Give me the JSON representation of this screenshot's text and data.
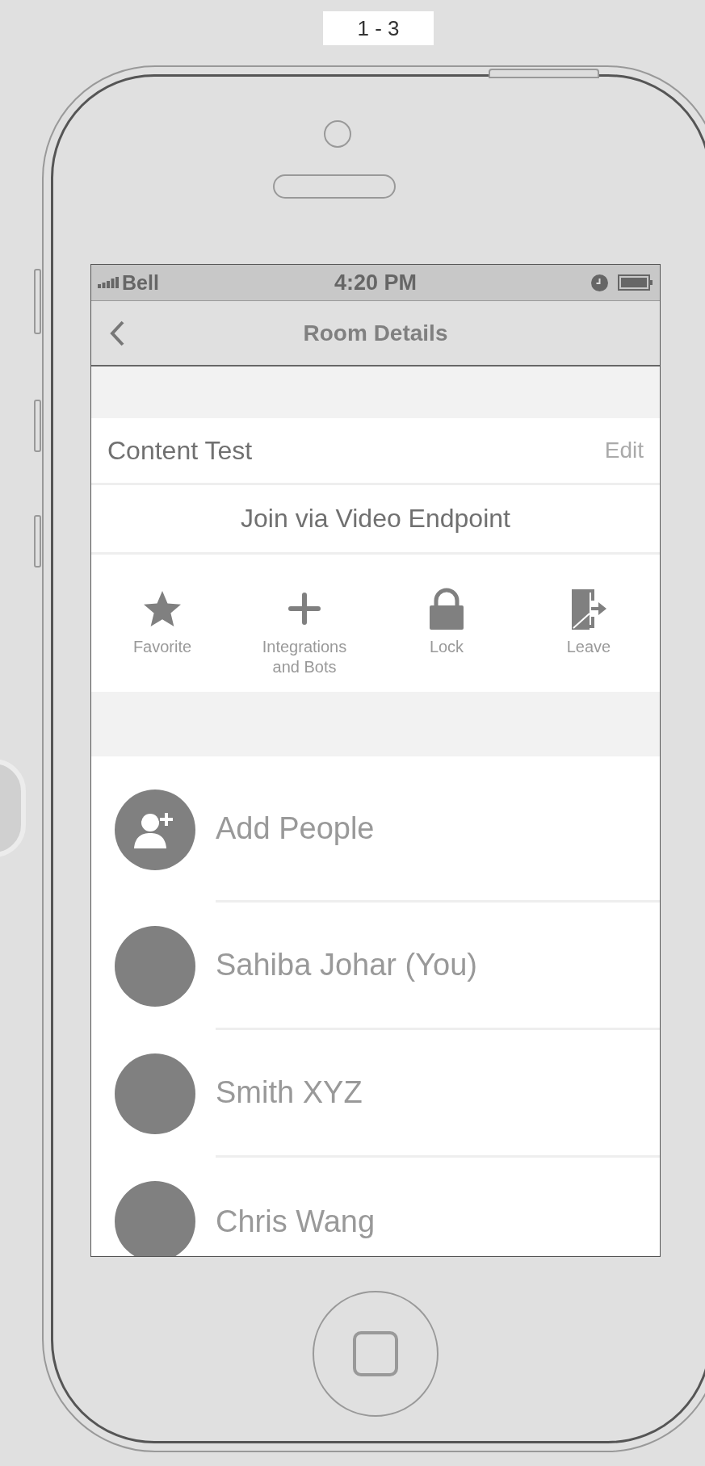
{
  "page_label": "1 - 3",
  "status_bar": {
    "carrier": "Bell",
    "time": "4:20 PM"
  },
  "nav": {
    "title": "Room Details"
  },
  "room": {
    "name": "Content Test",
    "edit": "Edit"
  },
  "join": "Join via Video Endpoint",
  "actions": [
    {
      "kind": "favorite",
      "label": "Favorite"
    },
    {
      "kind": "add",
      "label": "Integrations and Bots"
    },
    {
      "kind": "lock",
      "label": "Lock"
    },
    {
      "kind": "leave",
      "label": "Leave"
    }
  ],
  "people": [
    {
      "kind": "add",
      "name": "Add People"
    },
    {
      "kind": "member",
      "name": "Sahiba Johar (You)"
    },
    {
      "kind": "member",
      "name": "Smith XYZ"
    },
    {
      "kind": "member",
      "name": "Chris Wang"
    }
  ]
}
